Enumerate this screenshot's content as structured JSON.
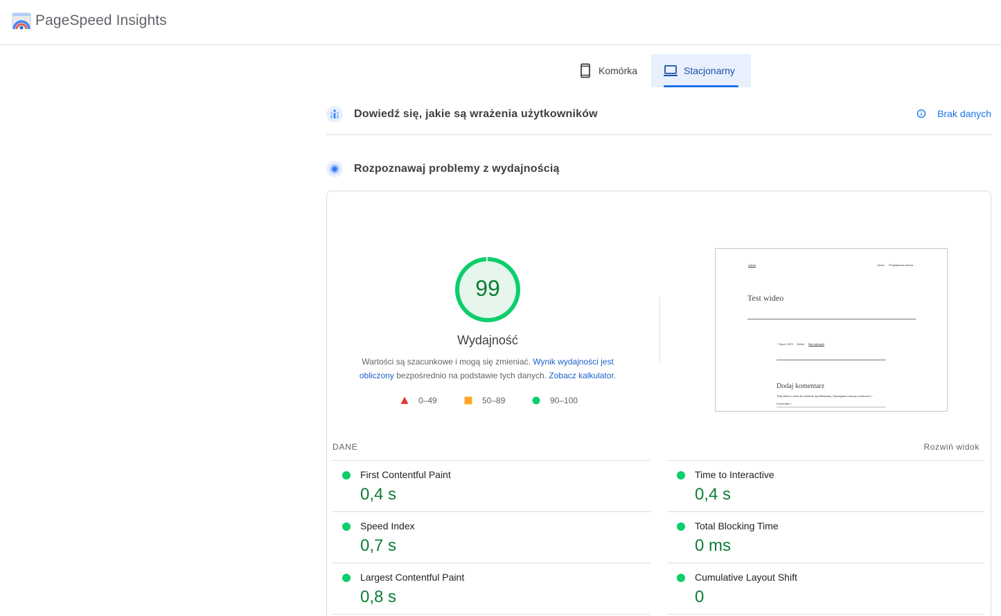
{
  "header": {
    "title": "PageSpeed Insights",
    "logo_icon": "pagespeed-logo-icon"
  },
  "tabs": [
    {
      "label": "Komórka",
      "icon": "phone-icon",
      "active": false
    },
    {
      "label": "Stacjonarny",
      "icon": "laptop-icon",
      "active": true
    }
  ],
  "sections": {
    "crux": {
      "title": "Dowiedź się, jakie są wrażenia użytkowników",
      "status": "Brak danych",
      "icon": "users-icon"
    },
    "lighthouse": {
      "title": "Rozpoznawaj problemy z wydajnością",
      "icon": "lighthouse-icon"
    }
  },
  "score": {
    "value": "99",
    "fraction": 0.99,
    "label": "Wydajność",
    "desc_1": "Wartości są szacunkowe i mogą się zmieniać. ",
    "link_1": "Wynik wydajności jest obliczony",
    "desc_2": " bezpośrednio na podstawie tych danych. ",
    "link_2": "Zobacz kalkulator",
    "desc_3": "."
  },
  "legend": [
    {
      "label": "0–49",
      "color": "#e53935",
      "shape": "triangle"
    },
    {
      "label": "50–89",
      "color": "#ffa726",
      "shape": "square"
    },
    {
      "label": "90–100",
      "color": "#0cce6b",
      "shape": "circle"
    }
  ],
  "preview": {
    "site_name": "Zaloto",
    "nav_1": "Home",
    "nav_2": "Przykładowa strona",
    "post_title": "Test wideo",
    "meta_date": "7 lipca, 2023",
    "meta_author": "Zaloto",
    "meta_category": "Bez kategorii",
    "comment_heading": "Dodaj komentarz",
    "comment_note": "Twój adres e-mail nie zostanie opublikowany. Wymagane pola są oznaczone *",
    "comment_label": "Komentarz *"
  },
  "metrics": {
    "section_label": "DANE",
    "expand_label": "Rozwiń widok",
    "items": [
      {
        "name": "First Contentful Paint",
        "value": "0,4 s"
      },
      {
        "name": "Time to Interactive",
        "value": "0,4 s"
      },
      {
        "name": "Speed Index",
        "value": "0,7 s"
      },
      {
        "name": "Total Blocking Time",
        "value": "0 ms"
      },
      {
        "name": "Largest Contentful Paint",
        "value": "0,8 s"
      },
      {
        "name": "Cumulative Layout Shift",
        "value": "0"
      }
    ]
  },
  "colors": {
    "accent": "#1a73e8",
    "good": "#0cce6b",
    "good_text": "#0c7d36"
  }
}
